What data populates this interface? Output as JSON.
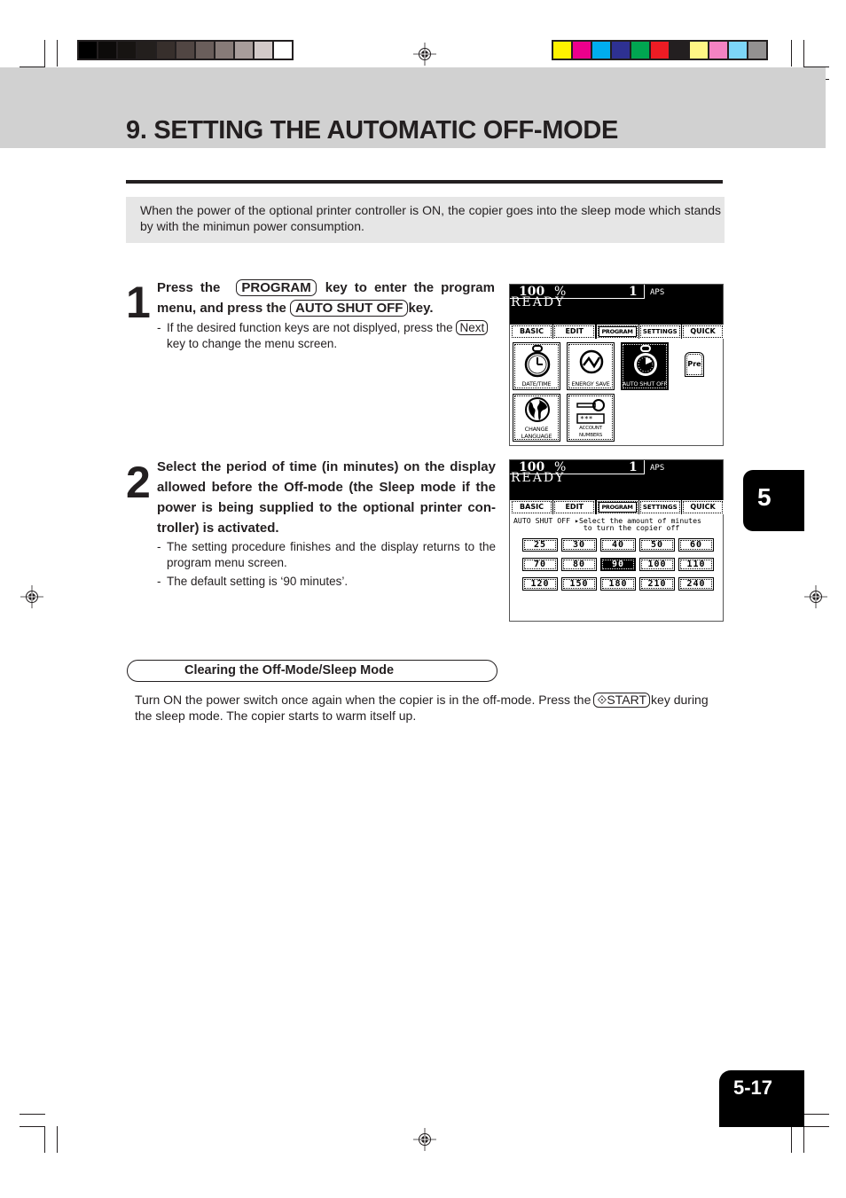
{
  "print_marks": {
    "gray_swatches": [
      "#000000",
      "#0d0b0a",
      "#171412",
      "#231f1d",
      "#372f2c",
      "#514643",
      "#6a5e5b",
      "#877b78",
      "#a89d9b",
      "#d3cac9",
      "#ffffff"
    ],
    "color_swatches": [
      "#fff200",
      "#ec008c",
      "#00aeef",
      "#2e3192",
      "#00a651",
      "#ed1c24",
      "#231f20",
      "#fff685",
      "#f383c3",
      "#7dd6f8",
      "#939191"
    ]
  },
  "header": {
    "title": "9. SETTING THE AUTOMATIC OFF-MODE"
  },
  "intro": "When the power of the optional printer controller is ON, the copier goes into the sleep mode which stands by with the minimun power consumption.",
  "steps": [
    {
      "number": "1",
      "text_parts": {
        "a": "Press the",
        "key1": "PROGRAM",
        "b": "key to enter the program menu, and  press the",
        "key2": "AUTO SHUT OFF",
        "c": "key."
      },
      "note": {
        "a": "If the desired function keys are not displyed, press the",
        "key": "Next",
        "b": "key to change the menu screen."
      }
    },
    {
      "number": "2",
      "text": "Select the period of time (in minutes) on the display allowed before the Off-mode (the Sleep mode if the power is being supplied to the optional printer con-troller) is activated.",
      "notes": [
        "The setting procedure finishes and the display returns to the program menu screen.",
        "The default setting is ‘90 minutes’."
      ]
    }
  ],
  "screen_common": {
    "zoom": "100",
    "percent": "%",
    "count": "1",
    "paper": "APS",
    "status": "READY",
    "tabs": [
      "BASIC",
      "EDIT",
      "PROGRAM",
      "SETTINGS",
      "QUICK"
    ],
    "active_tab": "PROGRAM"
  },
  "screen1": {
    "buttons": [
      {
        "label": "DATE/TIME",
        "icon": "stopwatch-icon"
      },
      {
        "label": "ENERGY SAVE",
        "icon": "energy-save-icon"
      },
      {
        "label": "AUTO SHUT OFF",
        "icon": "auto-shut-off-icon",
        "active": true
      },
      {
        "label": "CHANGE\nLANGUAGE",
        "icon": "globe-icon"
      },
      {
        "label": "ACCOUNT NUMBERS",
        "icon": "key-icon"
      }
    ],
    "pre_label": "Pre"
  },
  "screen2": {
    "message_line1": "AUTO SHUT OFF ▸Select the amount of minutes",
    "message_line2": "                to turn the copier off",
    "minutes": [
      "25",
      "30",
      "40",
      "50",
      "60",
      "70",
      "80",
      "90",
      "100",
      "110",
      "120",
      "150",
      "180",
      "210",
      "240"
    ],
    "selected": "90"
  },
  "clearing": {
    "heading": "Clearing the Off-Mode/Sleep Mode",
    "text_a": "Turn ON the power switch once again when the copier is in the off-mode.  Press the",
    "key": "⟐START",
    "text_b": "key during the sleep mode.  The copier starts to warm itself up."
  },
  "chapter_tab": "5",
  "page_number": "5-17"
}
